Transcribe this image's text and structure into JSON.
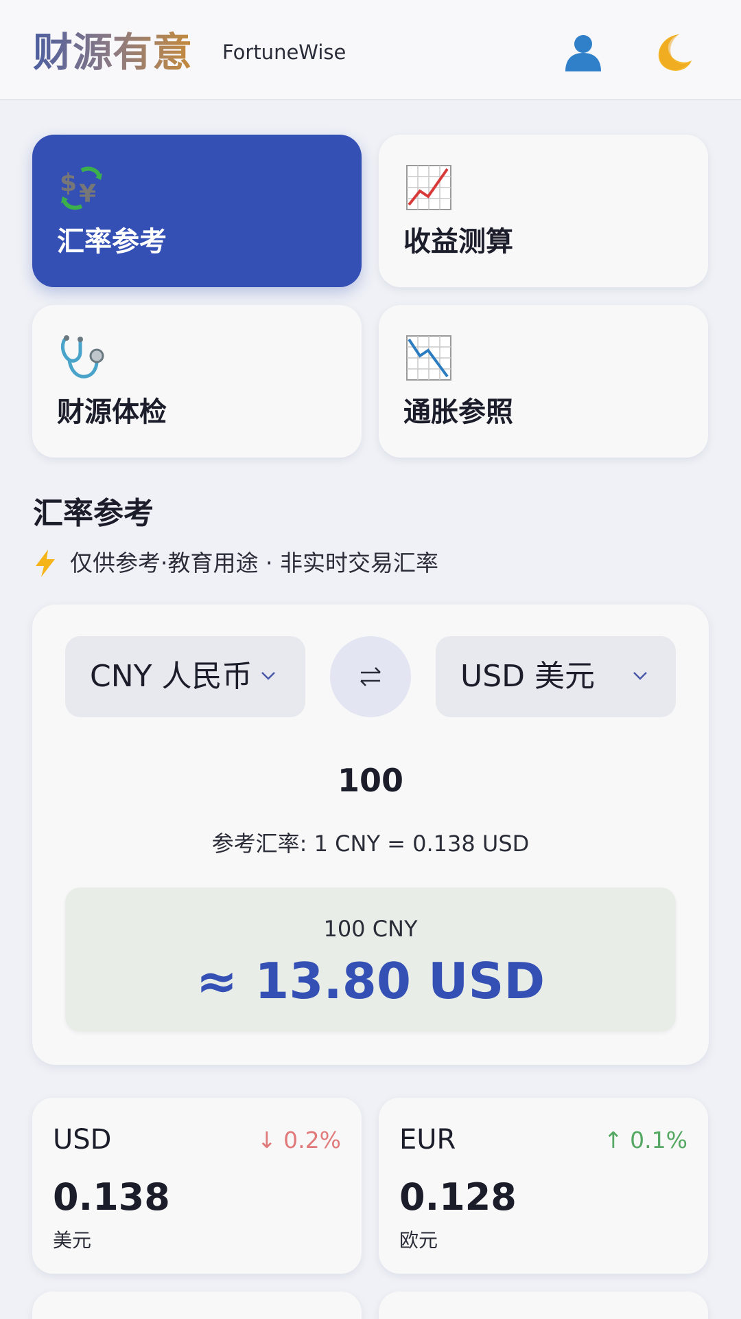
{
  "header": {
    "brand": "财源有意",
    "brand_en": "FortuneWise",
    "user_icon": "user-icon",
    "theme_icon": "moon-icon"
  },
  "tiles": [
    {
      "label": "汇率参考",
      "icon": "currency-exchange-icon",
      "active": true
    },
    {
      "label": "收益测算",
      "icon": "chart-up-icon",
      "active": false
    },
    {
      "label": "财源体检",
      "icon": "stethoscope-icon",
      "active": false
    },
    {
      "label": "通胀参照",
      "icon": "chart-down-icon",
      "active": false
    }
  ],
  "section": {
    "title": "汇率参考",
    "note": "仅供参考·教育用途 · 非实时交易汇率"
  },
  "converter": {
    "from": "CNY 人民币",
    "to": "USD 美元",
    "amount": "100",
    "rate_text": "参考汇率: 1 CNY = 0.138 USD",
    "result_source": "100 CNY",
    "result_value": "≈ 13.80 USD"
  },
  "rates": [
    {
      "code": "USD",
      "change": "↓ 0.2%",
      "direction": "down",
      "value": "0.138",
      "name": "美元"
    },
    {
      "code": "EUR",
      "change": "↑ 0.1%",
      "direction": "up",
      "value": "0.128",
      "name": "欧元"
    }
  ],
  "colors": {
    "accent": "#3550b5",
    "up": "#55a862",
    "down": "#e07a7a",
    "background": "#eff1f6"
  }
}
